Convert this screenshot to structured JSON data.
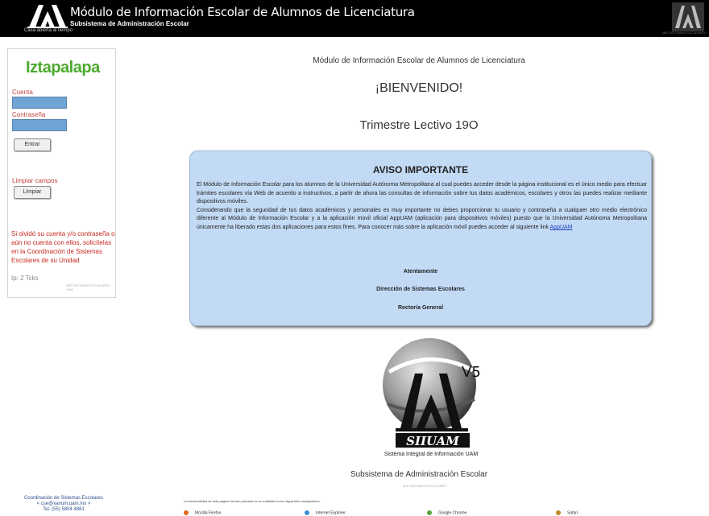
{
  "header": {
    "logo_caption": "Casa abierta al tiempo",
    "title": "Módulo de Información Escolar de Alumnos de Licenciatura",
    "subtitle": "Subsistema de Administración Escolar",
    "right_tag": "MIE SISTEMAS ESCOLARES"
  },
  "login": {
    "campus": "Iztapalapa",
    "account_label": "Cuenta",
    "account_value": "",
    "password_label": "Contraseña",
    "password_value": "",
    "enter_button": "Entrar",
    "clear_label": "Limpiar campos",
    "clear_button": "Limpiar",
    "forgot_message": "Si olvidó su cuenta y/o contraseña o aún no cuenta con ellos, solicítelas en la Coordinación de Sistemas Escolares de su Unidad",
    "ip_label": "Ip: 2 Tcks",
    "panel_tag": "MIE SISTEMAS ESCOLARES UAM"
  },
  "main": {
    "heading": "Módulo de Información Escolar de Alumnos de Licenciatura",
    "welcome": "¡BIENVENIDO!",
    "term": "Trimestre Lectivo 19O"
  },
  "notice": {
    "title": "AVISO IMPORTANTE",
    "paragraph1": "El Módulo de Información Escolar para los alumnos de la Universidad Autónoma Metropolitana al cual puedes acceder desde la página institucional es el único medio para efectuar trámites escolares vía Web de acuerdo a instructivos, a partir de ahora las consultas de información sobre tus datos académicos, escolares y otros las puedes realizar mediante dispositivos móviles.",
    "paragraph2": "Considerando que la seguridad de tus datos académicos y personales es muy importante no debes proporcionar tu usuario y contraseña a cualquier otro medio electrónico diferente al Módulo de Información Escolar y a la aplicación movil oficial AppUAM (aplicación para dispositivos móviles) puesto que la Universidad Autónoma Metropolitana únicamente ha liberado estas dos aplicaciones para estos fines. Para conocer más sobre la aplicación móvil puedes acceder al siguiente link",
    "link": "AppUAM",
    "closing": "Atentamente",
    "signer1": "Dirección de Sistemas Escolares",
    "signer2": "Rectoría General"
  },
  "siiuam": {
    "version": "V5",
    "name": "SIIUAM",
    "caption": "Sistema Integral de Información UAM"
  },
  "footer": {
    "subsystem": "Subsistema de Administración Escolar",
    "tag": "MIE SISTEMAS ESCOLARES",
    "coord_line1": "Coordinación de Sistemas Escolares",
    "coord_line2": "< cse@xanum.uam.mx >",
    "coord_line3": "Tel. (55) 5804 4881",
    "browser_note": "La funcionalidad de esta página ha sido probada en su totalidad en los siguientes navegadores:",
    "browsers": [
      "Mozilla Firefox",
      "Internet Explorer",
      "Google Chrome",
      "Safari"
    ]
  },
  "colors": {
    "header_bg": "#000000",
    "campus_green": "#4caa2e",
    "input_blue": "#6fa3d4",
    "notice_bg": "#c3daf5",
    "alert_red": "#c8281e"
  }
}
